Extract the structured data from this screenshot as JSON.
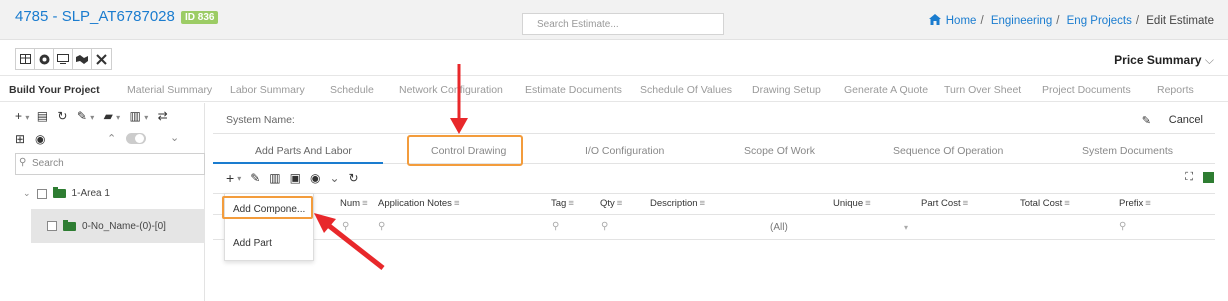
{
  "header": {
    "title": "4785 - SLP_AT6787028",
    "id_badge": "ID 836",
    "search_placeholder": "Search Estimate...",
    "breadcrumb": [
      "Home",
      "Engineering",
      "Eng Projects",
      "Edit Estimate"
    ]
  },
  "toolbar": {
    "icons": [
      "table-icon",
      "dashboard-icon",
      "monitor-icon",
      "handshake-icon",
      "tools-icon"
    ],
    "price_summary": "Price Summary"
  },
  "tabs": [
    "Build Your Project",
    "Material Summary",
    "Labor Summary",
    "Schedule",
    "Network Configuration",
    "Estimate Documents",
    "Schedule Of Values",
    "Drawing Setup",
    "Generate A Quote",
    "Turn Over Sheet",
    "Project Documents",
    "Reports"
  ],
  "sidebar": {
    "search_placeholder": "Search",
    "tree": [
      {
        "label": "1-Area 1"
      },
      {
        "label": "0-No_Name-(0)-[0]"
      }
    ]
  },
  "main": {
    "system_name_label": "System Name:",
    "cancel_label": "Cancel",
    "subtabs": [
      "Add Parts And Labor",
      "Control Drawing",
      "I/O Configuration",
      "Scope Of Work",
      "Sequence Of Operation",
      "System Documents"
    ],
    "columns": [
      "Num",
      "Application Notes",
      "Tag",
      "Qty",
      "Description",
      "Unique",
      "Part Cost",
      "Total Cost",
      "Prefix"
    ],
    "filter_all": "(All)",
    "menu": [
      "Add Compone...",
      "Add Part"
    ]
  },
  "colors": {
    "accent": "#1a7ccf",
    "badge": "#9ccc65",
    "highlight": "#f39c3c",
    "annotation_arrow": "#e8282b",
    "folder": "#2e7d32"
  }
}
